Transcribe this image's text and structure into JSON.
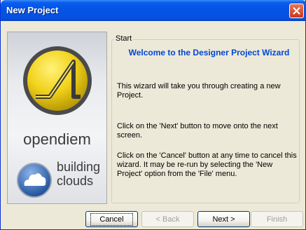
{
  "window": {
    "title": "New Project"
  },
  "sidebar": {
    "brand": "opendiem",
    "tagline_line1": "building",
    "tagline_line2": "clouds"
  },
  "group": {
    "legend": "Start"
  },
  "content": {
    "welcome": "Welcome to the Designer Project Wizard",
    "para1": "This wizard will take you through creating a new Project.",
    "para2": "Click on the 'Next' button to move onto the next screen.",
    "para3": "Click on the 'Cancel' button at any time to cancel this wizard.  It may be re-run by selecting the 'New Project' option from the 'File' menu."
  },
  "buttons": {
    "cancel": "Cancel",
    "back": "< Back",
    "next": "Next >",
    "finish": "Finish"
  },
  "colors": {
    "titlebar": "#0454e6",
    "welcome_text": "#0046d5",
    "logo_yellow": "#f2d21b",
    "close_button": "#c9381a"
  }
}
